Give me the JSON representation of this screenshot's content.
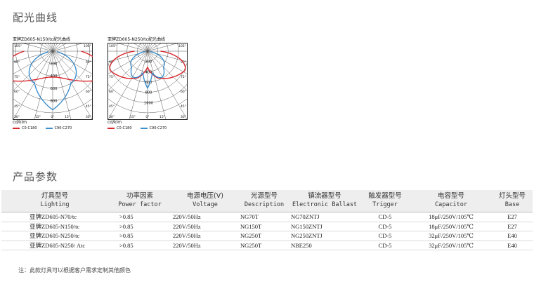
{
  "sections": {
    "curves_title": "配光曲线",
    "params_title": "产品参数"
  },
  "polar_charts": [
    {
      "caption": "亚牌ZD605-N150/tc配光曲线",
      "radial_ticks": [
        "200",
        "400",
        "600",
        "800"
      ],
      "radial_max": 1000,
      "angle_labels_left": [
        "105°",
        "90°",
        "75°",
        "60°",
        "45°",
        "30°"
      ],
      "angle_labels_right": [
        "105°",
        "90°",
        "75°",
        "60°",
        "45°",
        "30°"
      ],
      "bottom_labels": [
        "30°",
        "15°",
        "0°",
        "15°",
        "30°"
      ],
      "unit": "cd/klm",
      "legend": [
        "C0-C180",
        "C90-C270"
      ]
    },
    {
      "caption": "亚牌ZD605-N250/tc配光曲线",
      "radial_ticks": [
        "200",
        "400",
        "600",
        "800",
        "1000"
      ],
      "radial_max": 1200,
      "angle_labels_left": [
        "105°",
        "90°",
        "75°",
        "60°",
        "45°",
        "30°"
      ],
      "angle_labels_right": [
        "105°",
        "90°",
        "75°",
        "60°",
        "45°",
        "30°"
      ],
      "bottom_labels": [
        "30°",
        "15°",
        "0°",
        "15°",
        "30°"
      ],
      "unit": "cd/klm",
      "legend": [
        "C0-C180",
        "C90-C270"
      ]
    }
  ],
  "colors": {
    "series_c0": "#d9262c",
    "series_c90": "#3f8fcc",
    "grid": "#555555",
    "header_bg": "#eeeeee"
  },
  "table": {
    "headers": [
      {
        "cn": "灯具型号",
        "en": "Lighting"
      },
      {
        "cn": "功率因素",
        "en": "Power factor"
      },
      {
        "cn": "电源电压(V)",
        "en": "Voltage"
      },
      {
        "cn": "光源型号",
        "en": "Description"
      },
      {
        "cn": "镇流器型号",
        "en": "Electronic Ballast"
      },
      {
        "cn": "触发器型号",
        "en": "Trigger"
      },
      {
        "cn": "电容型号",
        "en": "Capacitor"
      },
      {
        "cn": "灯头型号",
        "en": "Base"
      }
    ],
    "rows": [
      [
        "亚牌ZD605-N70/tc",
        ">0.85",
        "220V/50Hz",
        "NG70T",
        "NG70ZNTJ",
        "CD-5",
        "18μF/250V/105℃",
        "E27"
      ],
      [
        "亚牌ZD605-N150/tc",
        ">0.85",
        "220V/50Hz",
        "NG150T",
        "NG150ZNTJ",
        "CD-5",
        "18μF/250V/105℃",
        "E27"
      ],
      [
        "亚牌ZD605-N250/tc",
        ">0.85",
        "220V/50Hz",
        "NG250T",
        "NG250ZNTJ",
        "CD-5",
        "32μF/250V/105℃",
        "E40"
      ],
      [
        "亚牌ZD605-N250/ Atc",
        ">0.85",
        "220V/50Hz",
        "NG250T",
        "NBE250",
        "CD-5",
        "32μF/250V/105℃",
        "E40"
      ]
    ]
  },
  "footnote": "注：此款灯具可以根据客户需求定制其他颜色"
}
